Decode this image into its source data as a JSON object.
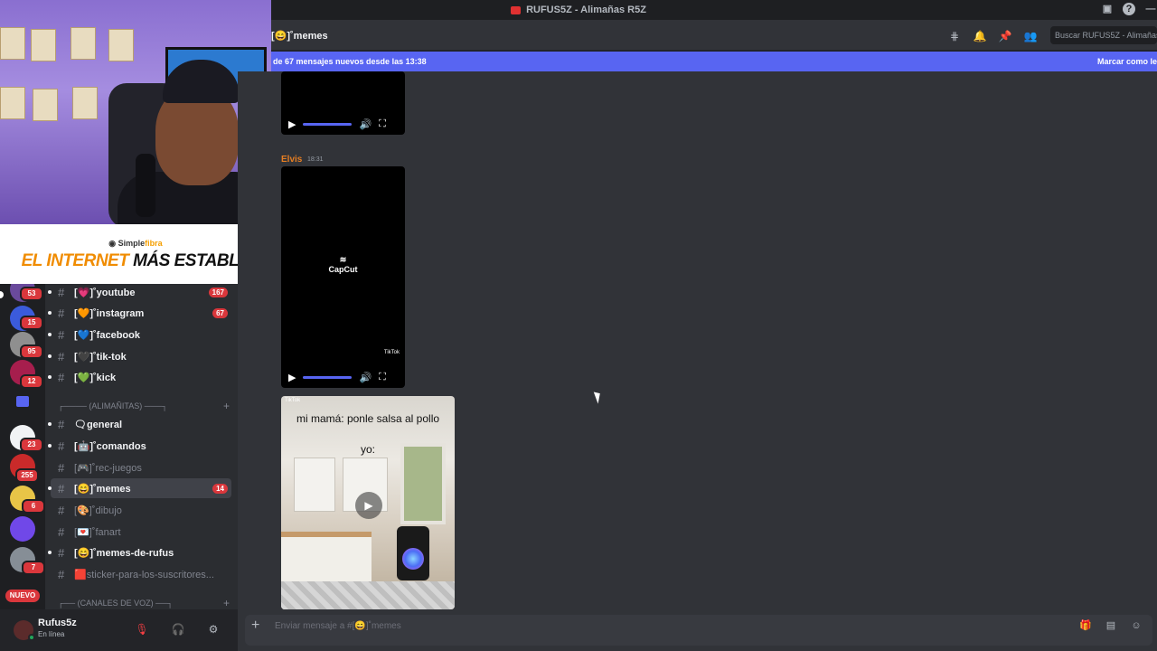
{
  "window": {
    "title": "RUFUS5Z - Alimañas R5Z"
  },
  "header": {
    "channel_name": "[😄]˚memes",
    "search_placeholder": "Buscar RUFUS5Z - Alimañas"
  },
  "new_messages_bar": {
    "text": "de 67 mensajes nuevos desde las 13:38",
    "action": "Marcar como le"
  },
  "overlay_ad": {
    "brand_part1": "Simple",
    "brand_part2": "fibra",
    "slogan_part1": "EL INTERNET ",
    "slogan_part2": "MÁS ESTABLE"
  },
  "server_rail": {
    "badges": [
      "53",
      "15",
      "95",
      "12",
      "23",
      "255",
      "6",
      "7"
    ],
    "new_label": "NUEVO"
  },
  "channels": {
    "top": [
      {
        "label": "[💗]˚youtube",
        "badge": "167"
      },
      {
        "label": "[🧡]˚instagram",
        "badge": "67"
      },
      {
        "label": "[💙]˚facebook",
        "badge": ""
      },
      {
        "label": "[🖤]˚tik-tok",
        "badge": ""
      },
      {
        "label": "[💚]˚kick",
        "badge": ""
      }
    ],
    "category_alimanitas": "┌──── (ALIMAÑITAS) ───┐",
    "alimanitas": [
      {
        "label": "🗨general",
        "badge": ""
      },
      {
        "label": "[🤖]˚comandos",
        "badge": ""
      },
      {
        "label": "[🎮]˚rec-juegos",
        "badge": ""
      },
      {
        "label": "[😄]˚memes",
        "badge": "14"
      },
      {
        "label": "[🎨]˚dibujo",
        "badge": ""
      },
      {
        "label": "[💌]˚fanart",
        "badge": ""
      },
      {
        "label": "[😄]˚memes-de-rufus",
        "badge": ""
      },
      {
        "label": "🟥sticker-para-los-suscritores...",
        "badge": ""
      }
    ],
    "category_voz": "┌── (CANALES DE VOZ) ──┐"
  },
  "user_panel": {
    "username": "Rufus5z",
    "status": "En línea"
  },
  "messages": {
    "author": "Elvis",
    "time": "18:31",
    "capcut_label": "CapCut",
    "tiktok_label": "TikTok",
    "meme_tag": "TikTok",
    "meme_line1": "mi mamá: ponle salsa al pollo",
    "meme_line2": "yo:"
  },
  "composer": {
    "placeholder": "Enviar mensaje a #[😄]˚memes"
  },
  "colors": {
    "accent": "#5865f2",
    "danger": "#da373c",
    "author": "#e67e22",
    "online": "#23a55a"
  }
}
